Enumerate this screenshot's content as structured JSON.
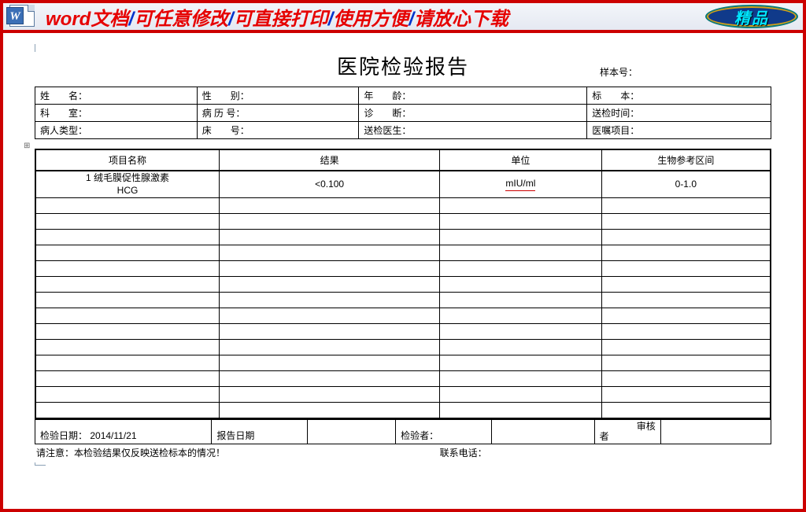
{
  "banner": {
    "segments": [
      "word文档",
      "可任意修改",
      "可直接打印",
      "使用方便",
      "请放心下载"
    ],
    "sep": "/",
    "badge": "精品"
  },
  "doc": {
    "title": "医院检验报告",
    "sample_label": "样本号：",
    "anchor_mark": "⊞"
  },
  "info": {
    "r1": {
      "c1": "姓　　名：",
      "c2": "性　　别：",
      "c3": "年　　龄：",
      "c4": "标　　本："
    },
    "r2": {
      "c1": "科　　室：",
      "c2": "病  历  号：",
      "c3": "诊　　断：",
      "c4": "送检时间："
    },
    "r3": {
      "c1": "病人类型：",
      "c2": "床　　号：",
      "c3": "送检医生：",
      "c4": "医嘱项目："
    }
  },
  "results": {
    "headers": {
      "h1": "项目名称",
      "h2": "结果",
      "h3": "单位",
      "h4": "生物参考区间"
    },
    "row1": {
      "item_line1": "1 绒毛膜促性腺激素",
      "item_line2": "HCG",
      "value": "<0.100",
      "unit": "mIU/ml",
      "range": "0-1.0"
    }
  },
  "footer_row": {
    "c1a": "检验日期：",
    "c1b": "2014/11/21",
    "c2": "报告日期",
    "c4": "检验者：",
    "c6a": "审核",
    "c6b": "者"
  },
  "footer_note": {
    "note": "请注意：本检验结果仅反映送检标本的情况！",
    "phone": "联系电话："
  }
}
